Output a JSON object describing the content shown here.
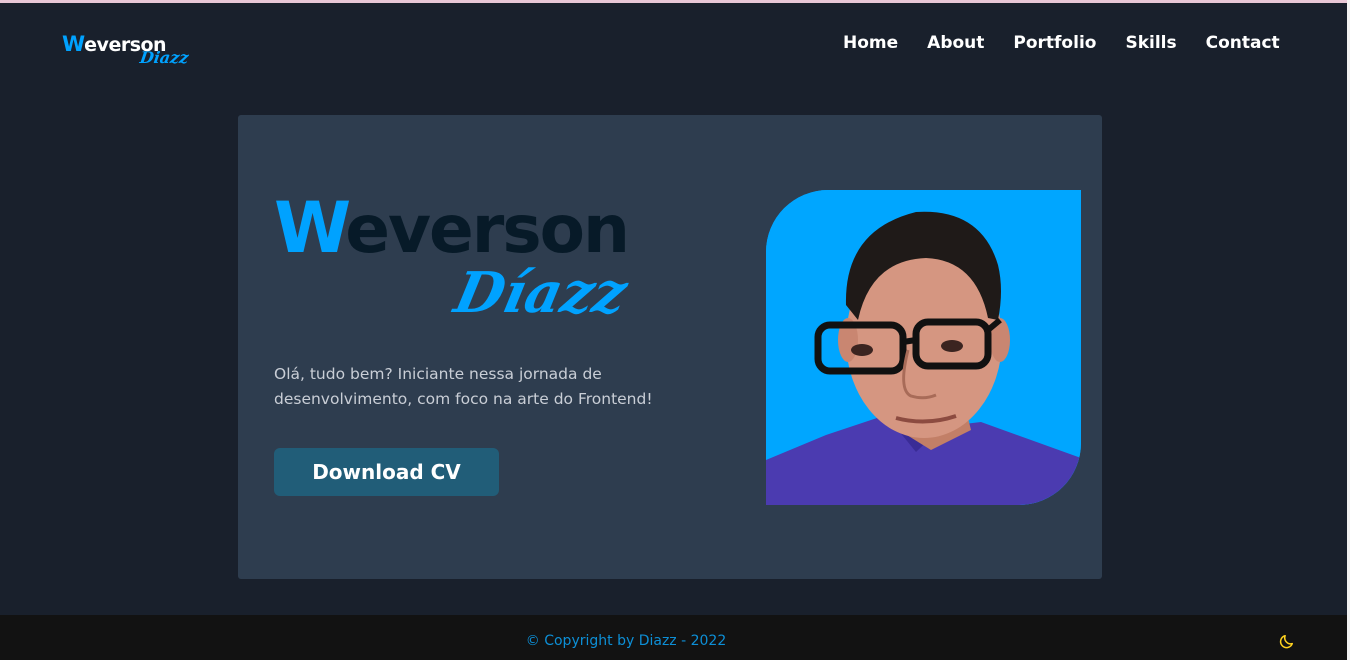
{
  "header": {
    "logo": {
      "first_initial": "W",
      "first_rest": "everson",
      "last": "Diazz"
    },
    "nav": [
      "Home",
      "About",
      "Portfolio",
      "Skills",
      "Contact"
    ]
  },
  "hero": {
    "name_initial": "W",
    "name_rest": "everson",
    "last_name": "Díazz",
    "intro": "Olá, tudo bem? Iniciante nessa jornada de desenvolvimento, com foco na arte do Frontend!",
    "cta_label": "Download CV"
  },
  "footer": {
    "copyright": "© Copyright by Diazz - 2022",
    "theme_toggle_icon": "moon-icon"
  },
  "colors": {
    "background": "#19202c",
    "card": "#2e3d4f",
    "accent": "#00a2ff",
    "button": "#215d78",
    "footer": "#121212",
    "moon": "#ffd21f"
  }
}
